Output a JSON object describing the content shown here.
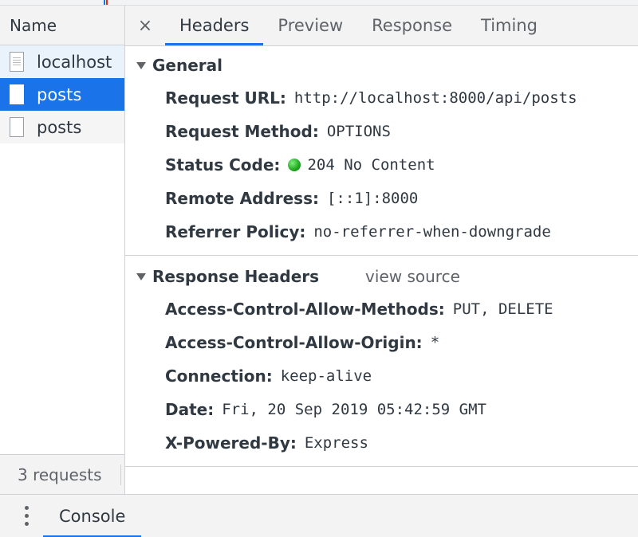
{
  "sidebar": {
    "header": "Name",
    "requests": [
      {
        "name": "localhost",
        "icon": "document-icon"
      },
      {
        "name": "posts",
        "icon": "file-icon"
      },
      {
        "name": "posts",
        "icon": "file-icon"
      }
    ],
    "footer": "3 requests"
  },
  "tabs": {
    "close": "×",
    "items": [
      "Headers",
      "Preview",
      "Response",
      "Timing"
    ],
    "active": "Headers"
  },
  "general": {
    "title": "General",
    "rows": [
      {
        "key": "Request URL:",
        "value": "http://localhost:8000/api/posts"
      },
      {
        "key": "Request Method:",
        "value": "OPTIONS"
      },
      {
        "key": "Status Code:",
        "value": "204 No Content"
      },
      {
        "key": "Remote Address:",
        "value": "[::1]:8000"
      },
      {
        "key": "Referrer Policy:",
        "value": "no-referrer-when-downgrade"
      }
    ]
  },
  "response_headers": {
    "title": "Response Headers",
    "view_source": "view source",
    "rows": [
      {
        "key": "Access-Control-Allow-Methods:",
        "value": "PUT, DELETE"
      },
      {
        "key": "Access-Control-Allow-Origin:",
        "value": "*"
      },
      {
        "key": "Connection:",
        "value": "keep-alive"
      },
      {
        "key": "Date:",
        "value": "Fri, 20 Sep 2019 05:42:59 GMT"
      },
      {
        "key": "X-Powered-By:",
        "value": "Express"
      }
    ]
  },
  "drawer": {
    "menu_icon": "more-vertical-icon",
    "console_tab": "Console"
  },
  "colors": {
    "accent": "#1a73e8",
    "status_ok": "#1fa61f"
  }
}
